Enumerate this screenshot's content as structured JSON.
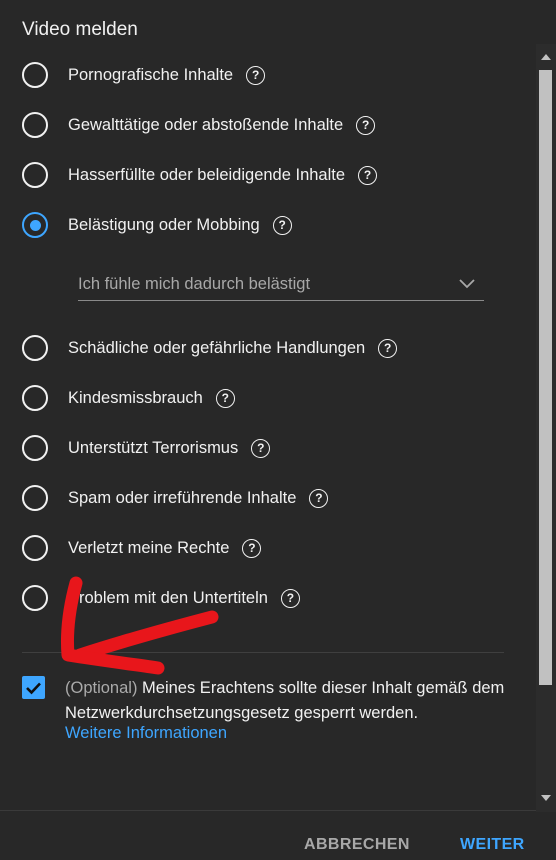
{
  "dialog": {
    "title": "Video melden",
    "options": [
      {
        "label": "Pornografische Inhalte",
        "selected": false
      },
      {
        "label": "Gewalttätige oder abstoßende Inhalte",
        "selected": false
      },
      {
        "label": "Hasserfüllte oder beleidigende Inhalte",
        "selected": false
      },
      {
        "label": "Belästigung oder Mobbing",
        "selected": true
      },
      {
        "label": "Schädliche oder gefährliche Handlungen",
        "selected": false
      },
      {
        "label": "Kindesmissbrauch",
        "selected": false
      },
      {
        "label": "Unterstützt Terrorismus",
        "selected": false
      },
      {
        "label": "Spam oder irreführende Inhalte",
        "selected": false
      },
      {
        "label": "Verletzt meine Rechte",
        "selected": false
      },
      {
        "label": "Problem mit den Untertiteln",
        "selected": false
      }
    ],
    "help_glyph": "?",
    "subreason": {
      "selected_value": "Ich fühle mich dadurch belästigt"
    },
    "netzdg": {
      "checked": true,
      "optional_text": "(Optional)",
      "text": " Meines Erachtens sollte dieser Inhalt gemäß dem Netzwerkdurchsetzungsgesetz gesperrt werden.",
      "more_link": "Weitere Informationen"
    },
    "buttons": {
      "cancel": "ABBRECHEN",
      "next": "WEITER"
    }
  },
  "colors": {
    "accent": "#3ea6ff",
    "background": "#282828",
    "annotation": "#e8161b"
  },
  "icons": [
    "radio-icon",
    "help-icon",
    "chevron-down-icon",
    "checkmark-icon",
    "red-arrow-annotation"
  ]
}
